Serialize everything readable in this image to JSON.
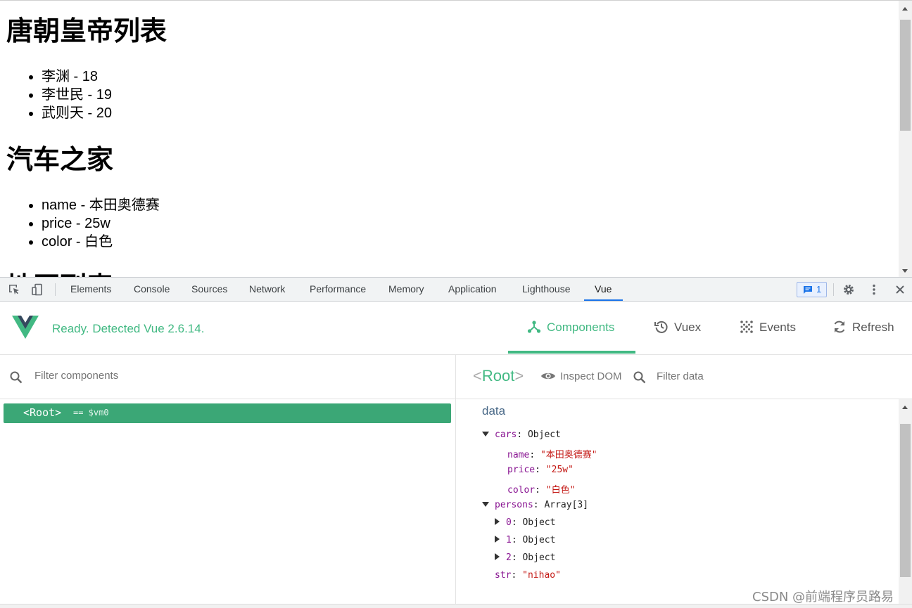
{
  "webpage": {
    "heading1": "唐朝皇帝列表",
    "emperors": [
      "李渊 - 18",
      "李世民 - 19",
      "武则天 - 20"
    ],
    "heading2": "汽车之家",
    "car_items": [
      "name - 本田奥德赛",
      "price - 25w",
      "color - 白色"
    ],
    "heading3_partial": "地区列表"
  },
  "devtools": {
    "tabs": [
      "Elements",
      "Console",
      "Sources",
      "Network",
      "Performance",
      "Memory",
      "Application",
      "Lighthouse",
      "Vue"
    ],
    "active_tab": "Vue",
    "message_count": "1",
    "accent": "#1a73e8"
  },
  "vue": {
    "status": "Ready. Detected Vue 2.6.14.",
    "nav": {
      "components": "Components",
      "vuex": "Vuex",
      "events": "Events",
      "refresh": "Refresh"
    },
    "brand_color": "#42b983",
    "filter_components_placeholder": "Filter components",
    "selected_component": "Root",
    "vm_label": "== $vm0",
    "inspect_dom": "Inspect DOM",
    "filter_data_placeholder": "Filter data",
    "data_section": "data",
    "tree": {
      "cars_key": "cars",
      "cars_type": "Object",
      "name_key": "name",
      "name_val": "\"本田奥德赛\"",
      "price_key": "price",
      "price_val": "\"25w\"",
      "color_key": "color",
      "color_val": "\"白色\"",
      "persons_key": "persons",
      "persons_type": "Array[3]",
      "p0_key": "0",
      "p0_type": "Object",
      "p1_key": "1",
      "p1_type": "Object",
      "p2_key": "2",
      "p2_type": "Object",
      "str_key": "str",
      "str_val": "\"nihao\""
    }
  },
  "watermark": "CSDN @前端程序员路易"
}
